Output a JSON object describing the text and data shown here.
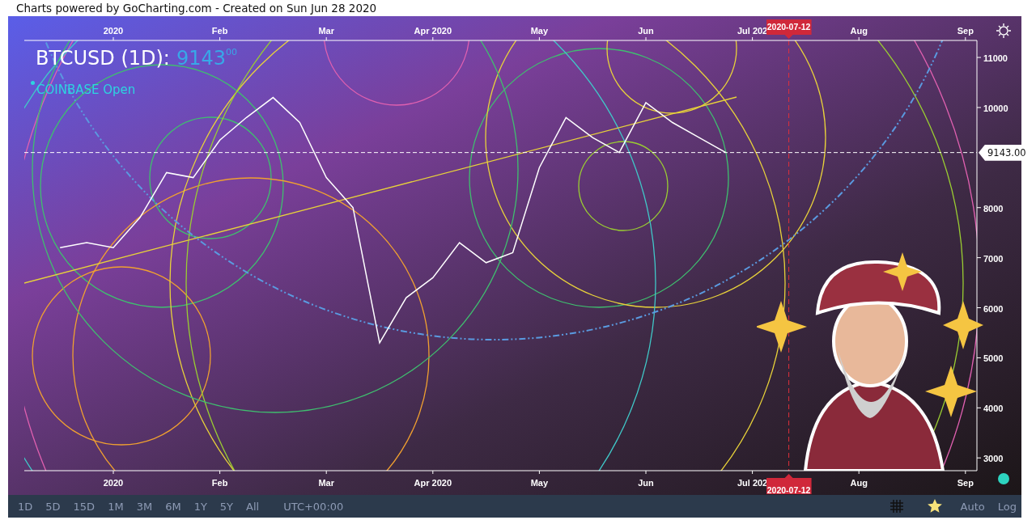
{
  "caption": "Charts powered by GoCharting.com - Created on Sun Jun 28 2020",
  "chart": {
    "symbol": "BTCUSD (1D):",
    "price": "9143",
    "price_decimals": "00",
    "exchange": "COINBASE Open",
    "marker_top": "2020-07-12",
    "marker_bottom": "2020-07-12",
    "top_axis_labels": [
      "2020",
      "Feb",
      "Mar",
      "Apr 2020",
      "May",
      "Jun",
      "Jul 202",
      "Aug",
      "Sep"
    ],
    "last_price_label": "9143.00",
    "chart_data": {
      "type": "line",
      "categories": [
        null,
        null,
        "2020",
        null,
        null,
        null,
        "Feb",
        null,
        null,
        null,
        "Mar",
        null,
        null,
        null,
        "Apr 2020",
        null,
        null,
        null,
        "May",
        null,
        null,
        null,
        "Jun",
        null,
        null,
        null,
        "Jul 202",
        null,
        null,
        null,
        "Aug",
        null,
        null,
        null,
        "Sep"
      ],
      "series": [
        {
          "color": "#ffffff",
          "values": [
            7200,
            7300,
            7200,
            7800,
            8700,
            8600,
            9350,
            9800,
            10200,
            9700,
            8600,
            8000,
            5300,
            6200,
            6600,
            7300,
            6900,
            7100,
            8800,
            9800,
            9400,
            9100,
            10100,
            9700,
            9400,
            9100,
            null,
            null,
            null,
            null,
            null,
            null,
            null,
            null,
            null
          ]
        }
      ],
      "ylim": [
        2745,
        11340
      ],
      "yticks": [
        3000,
        4000,
        5000,
        6000,
        7000,
        8000,
        10000,
        11000
      ]
    }
  },
  "toolbar": {
    "ranges": [
      {
        "label": "1D"
      },
      {
        "label": "5D"
      },
      {
        "label": "15D"
      },
      {
        "label": "1M"
      },
      {
        "label": "3M"
      },
      {
        "label": "6M"
      },
      {
        "label": "1Y"
      },
      {
        "label": "5Y"
      },
      {
        "label": "All"
      }
    ],
    "timezone": "UTC+00:00",
    "scale_buttons": [
      "Auto",
      "Log"
    ]
  }
}
